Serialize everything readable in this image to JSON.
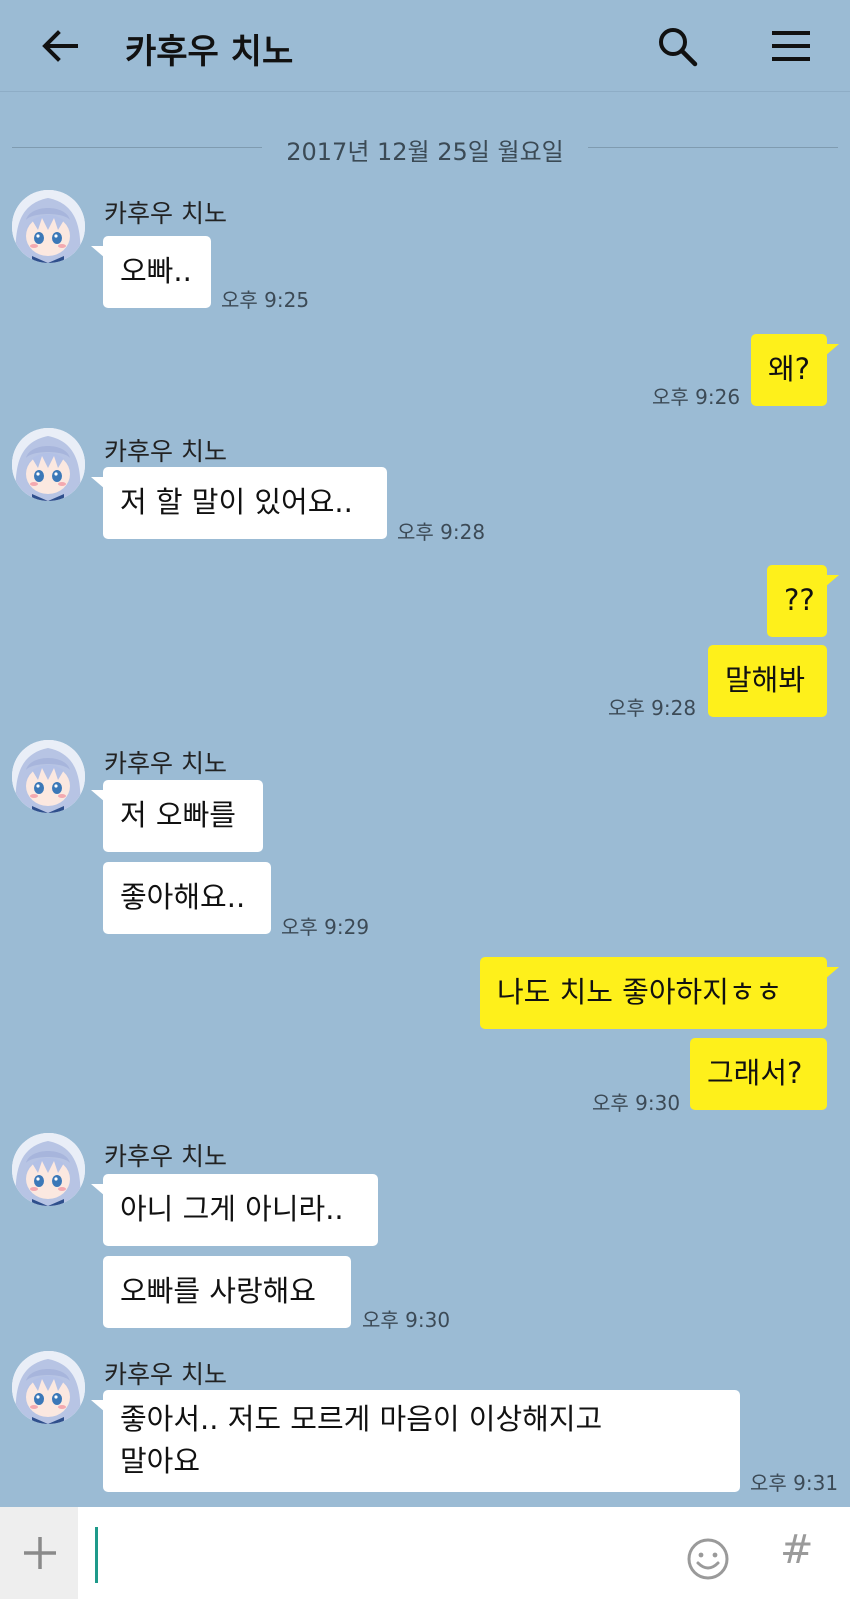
{
  "header": {
    "back_icon": "arrow-left-icon",
    "title": "카후우 치노",
    "search_icon": "search-icon",
    "menu_icon": "hamburger-menu-icon"
  },
  "date_separator": "2017년 12월 25일 월요일",
  "messages": [
    {
      "sender": "카후우 치노",
      "text": "오빠..",
      "time": "오후 9:25"
    },
    {
      "text": "왜?",
      "time": "오후 9:26"
    },
    {
      "sender": "카후우 치노",
      "text": "저 할 말이 있어요..",
      "time": "오후 9:28"
    },
    {
      "text": "??"
    },
    {
      "text": "말해봐",
      "time": "오후 9:28"
    },
    {
      "sender": "카후우 치노",
      "text": "저 오빠를"
    },
    {
      "text": "좋아해요..",
      "time": "오후 9:29"
    },
    {
      "text": "나도 치노 좋아하지ㅎㅎ"
    },
    {
      "text": "그래서?",
      "time": "오후 9:30"
    },
    {
      "sender": "카후우 치노",
      "text": "아니 그게 아니라.."
    },
    {
      "text": "오빠를 사랑해요",
      "time": "오후 9:30"
    },
    {
      "sender": "카후우 치노",
      "text_line1": "좋아서.. 저도 모르게 마음이 이상해지고",
      "text_line2": "말아요",
      "time": "오후 9:31"
    }
  ],
  "input_bar": {
    "plus_icon": "plus-icon",
    "emoji_icon": "emoji-icon",
    "hash": "#"
  },
  "colors": {
    "background": "#9bbbd4",
    "incoming_bubble": "#ffffff",
    "outgoing_bubble": "#fef01b",
    "cursor": "#1e9a8a"
  }
}
